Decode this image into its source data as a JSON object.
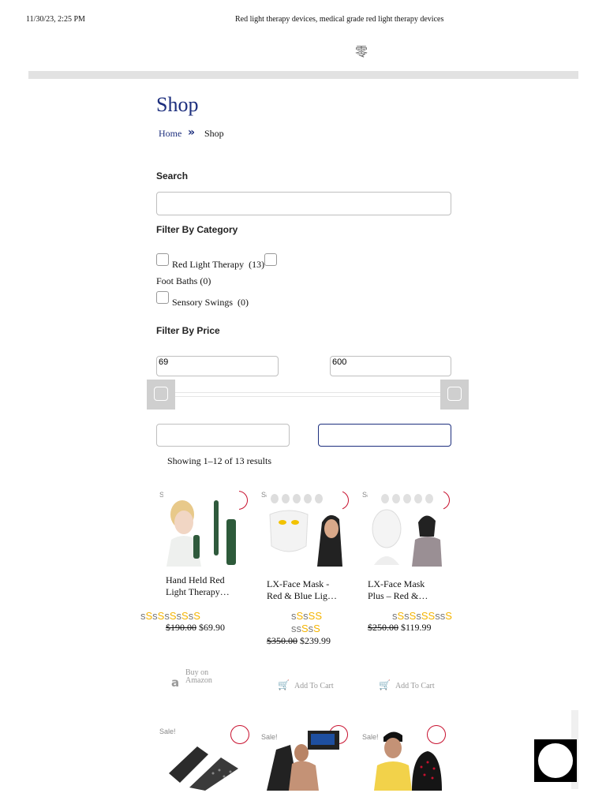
{
  "header": {
    "timestamp": "11/30/23, 2:25 PM",
    "doc_title": "Red light therapy devices, medical grade red light therapy devices",
    "glyph": "零"
  },
  "page": {
    "title": "Shop",
    "breadcrumb": {
      "home": "Home",
      "separator": "»",
      "current": "Shop"
    }
  },
  "filters": {
    "search_label": "Search",
    "search_value": "",
    "category_label": "Filter By Category",
    "categories": [
      {
        "label": "Red Light Therapy",
        "count": "(13)"
      },
      {
        "label": "Foot Baths",
        "count": "(0)"
      },
      {
        "label": "Sensory Swings",
        "count": "(0)"
      }
    ],
    "price_label": "Filter By Price",
    "price_min": "69",
    "price_max": "600"
  },
  "results": {
    "showing": "Showing 1–12 of 13 results"
  },
  "products": [
    {
      "sale": "Sale!",
      "name_line1": "Hand Held Red",
      "name_line2": "Light Therapy…",
      "stars": "sSsSsSsSsS",
      "old_price": "$190.00",
      "new_price": "$69.90",
      "button_label": "Buy on Amazon",
      "button_icon": "amazon-icon"
    },
    {
      "sale": "Sale!",
      "name_line1": "LX-Face Mask -",
      "name_line2": "Red & Blue Lig…",
      "stars_line1": "sSsSS",
      "stars_line2": "sSsSsS",
      "old_price": "$350.00",
      "new_price": "$239.99",
      "button_label": "Add To Cart",
      "button_icon": "cart-icon"
    },
    {
      "sale": "Sale!",
      "name_line1": "LX-Face Mask",
      "name_line2": "Plus – Red &…",
      "stars": "sSsSsSSssS",
      "old_price": "$250.00",
      "new_price": "$119.99",
      "button_label": "Add To Cart",
      "button_icon": "cart-icon"
    },
    {
      "sale": "Sale!"
    },
    {
      "sale": "Sale!"
    },
    {
      "sale": "Sale!"
    }
  ],
  "widget": {
    "counter": "0"
  },
  "colors": {
    "brand_blue": "#1d2f7e",
    "wishlist_red": "#c8102e",
    "star_gold": "#f4b400"
  }
}
